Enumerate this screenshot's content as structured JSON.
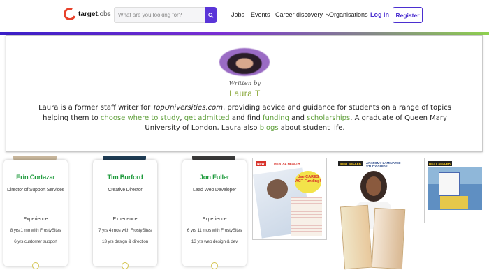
{
  "navbar": {
    "logo_bold": "target",
    "logo_light": ".obs",
    "search_placeholder": "What are you looking for?",
    "links": {
      "jobs": "Jobs",
      "events": "Events",
      "career_discovery": "Career discovery",
      "organisations": "Organisations",
      "login": "Log in"
    },
    "register": "Register"
  },
  "author": {
    "written_by": "Written by",
    "name": "Laura T",
    "bio": {
      "p1": "Laura is a former staff writer for ",
      "site": "TopUniversities.com",
      "p2": ", providing advice and guidance for students on a range of topics helping them to ",
      "link1": "choose where to study",
      "p3": ", ",
      "link2": "get admitted",
      "p4": " and find ",
      "link3": "funding",
      "p5": " and ",
      "link4": "scholarships",
      "p6": ". A graduate of Queen Mary University of London, Laura also ",
      "link5": "blogs",
      "p7": " about student life."
    }
  },
  "team": [
    {
      "name": "Erin Cortazar",
      "title": "Director of Support Services",
      "experience_label": "Experience",
      "exp1": "8 yrs 1 mo with FrostySites",
      "exp2": "6 yrs customer support"
    },
    {
      "name": "Tim Burford",
      "title": "Creative Director",
      "experience_label": "Experience",
      "exp1": "7 yrs 4 mos with FrostySites",
      "exp2": "13 yrs design & direction"
    },
    {
      "name": "Jon Fuller",
      "title": "Lead Web Developer",
      "experience_label": "Experience",
      "exp1": "6 yrs 11 mos with FrostySites",
      "exp2": "13 yrs web design & dev"
    }
  ],
  "products": [
    {
      "tag": "NEW",
      "title": "MENTAL HEALTH",
      "badge": "Use CARES ACT Funding!"
    },
    {
      "tag": "BEST SELLER",
      "title": "ANATOMY LAMINATED STUDY GUIDE"
    },
    {
      "tag": "BEST SELLER",
      "title": ""
    }
  ],
  "colors": {
    "brand_purple": "#4b2fd0",
    "link_green": "#5d9e38",
    "name_green": "#1d9a3b",
    "logo_red": "#e8412b"
  }
}
